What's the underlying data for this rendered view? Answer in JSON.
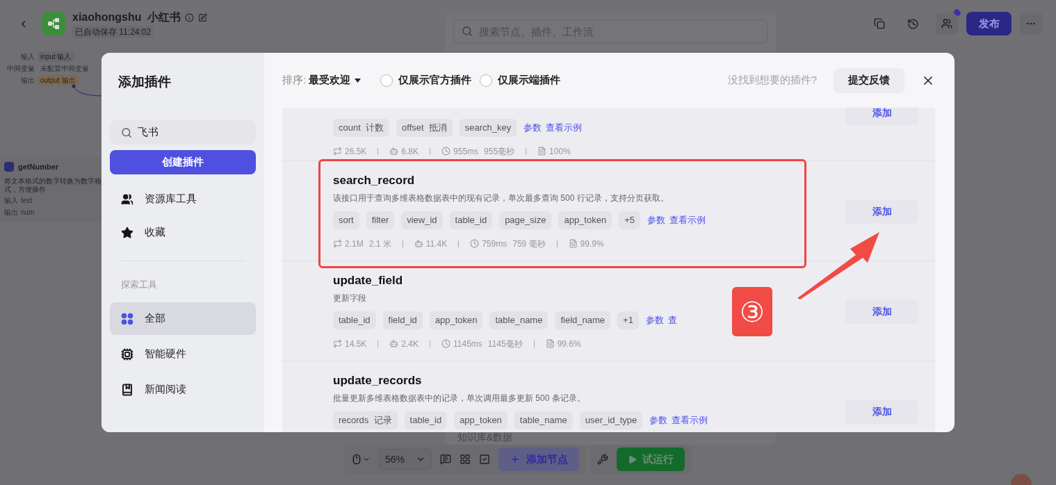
{
  "header": {
    "back": "‹",
    "title": "xiaohongshu  小红书",
    "saved": "已自动保存 11:24:02",
    "search_placeholder": "搜索节点、插件、工作流",
    "publish": "发布"
  },
  "canvas": {
    "node_rows": [
      {
        "label": "输入",
        "value": "input 输入",
        "kind": "tag"
      },
      {
        "label": "中间变量",
        "value": "未配置中间变量",
        "kind": "plain"
      },
      {
        "label": "输出",
        "value": "output 输出",
        "kind": "warn"
      }
    ],
    "node": {
      "title": "getNumber",
      "desc": "将文本格式的数字转换为数字格式，方便操作",
      "rows": [
        {
          "label": "输入",
          "value": "text"
        },
        {
          "label": "输出",
          "value": "num"
        }
      ]
    }
  },
  "panel_label": "知识库&数据",
  "toolbar": {
    "zoom": "56%",
    "add_node": "添加节点",
    "run": "试运行"
  },
  "modal": {
    "title": "添加插件",
    "search_value": "飞书",
    "create": "创建插件",
    "nav": [
      {
        "label": "资源库工具"
      },
      {
        "label": "收藏"
      }
    ],
    "section": "探索工具",
    "categories": [
      {
        "label": "全部",
        "selected": true
      },
      {
        "label": "智能硬件",
        "selected": false
      },
      {
        "label": "新闻阅读",
        "selected": false
      }
    ],
    "sort_label": "排序:",
    "sort_value": "最受欢迎",
    "filters": [
      {
        "label": "仅展示官方插件",
        "checked": false
      },
      {
        "label": "仅展示端插件",
        "checked": false
      }
    ],
    "feedback_hint": "没找到想要的插件?",
    "feedback": "提交反馈",
    "plugins": [
      {
        "tags": [
          "count  计数",
          "offset  抵消",
          "search_key"
        ],
        "links": [
          "参数",
          "查看示例"
        ],
        "stats": [
          [
            "26.5K"
          ],
          [
            "6.8K"
          ],
          [
            "955ms",
            "955毫秒"
          ],
          [
            "100%"
          ]
        ],
        "add": "添加",
        "highlighted": false
      },
      {
        "name": "search_record",
        "desc": "该接口用于查询多维表格数据表中的现有记录，单次最多查询 500 行记录，支持分页获取。",
        "tags": [
          "sort",
          "filter",
          "view_id",
          "table_id",
          "page_size",
          "app_token",
          "+5"
        ],
        "links": [
          "参数",
          "查看示例"
        ],
        "stats": [
          [
            "2.1M",
            "2.1 米"
          ],
          [
            "11.4K"
          ],
          [
            "759ms",
            "759 毫秒"
          ],
          [
            "99.9%"
          ]
        ],
        "add": "添加",
        "highlighted": true
      },
      {
        "name": "update_field",
        "desc": "更新字段",
        "tags": [
          "table_id",
          "field_id",
          "app_token",
          "table_name",
          "field_name",
          "+1"
        ],
        "links": [
          "参数",
          "查"
        ],
        "stats": [
          [
            "14.5K"
          ],
          [
            "2.4K"
          ],
          [
            "1145ms",
            "1145毫秒"
          ],
          [
            "99.6%"
          ]
        ],
        "add": "添加",
        "highlighted": false
      },
      {
        "name": "update_records",
        "desc": "批量更新多维表格数据表中的记录，单次调用最多更新 500 条记录。",
        "tags": [
          "records  记录",
          "table_id",
          "app_token",
          "table_name",
          "user_id_type"
        ],
        "links": [
          "参数",
          "查看示例"
        ],
        "add": "添加",
        "highlighted": false
      }
    ]
  },
  "annotation": {
    "step": "③"
  }
}
